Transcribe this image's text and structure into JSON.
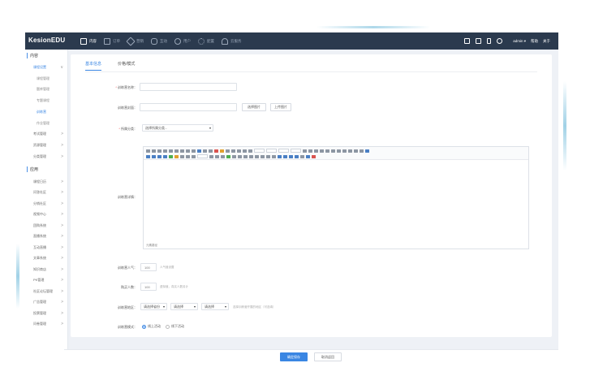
{
  "app": {
    "logo_main": "Kesion",
    "logo_sub": "EDU"
  },
  "topnav": [
    {
      "label": "内容",
      "icon": "document-icon",
      "active": true
    },
    {
      "label": "订单",
      "icon": "order-icon"
    },
    {
      "label": "营销",
      "icon": "tag-icon"
    },
    {
      "label": "互动",
      "icon": "chat-icon"
    },
    {
      "label": "用户",
      "icon": "user-icon"
    },
    {
      "label": "配置",
      "icon": "gear-icon"
    },
    {
      "label": "云服务",
      "icon": "cloud-icon"
    }
  ],
  "topright": {
    "user": "admin ▾",
    "help": "帮助",
    "about": "关于"
  },
  "sidebar": {
    "section_content": "内容",
    "items_content": [
      {
        "label": "课程设置",
        "arrow": "∨",
        "active": true
      },
      {
        "label": "课程管理",
        "sub": true
      },
      {
        "label": "题库管理",
        "sub": true
      },
      {
        "label": "专题课程",
        "sub": true
      },
      {
        "label": "训练营",
        "sub": true,
        "on": true
      },
      {
        "label": "作业管理",
        "sub": true
      },
      {
        "label": "考试管理",
        "arrow": ">"
      },
      {
        "label": "资源管理",
        "arrow": ">"
      },
      {
        "label": "分类管理",
        "arrow": ">"
      }
    ],
    "section_apps": "应用",
    "items_apps": [
      {
        "label": "课程日历",
        "arrow": ">"
      },
      {
        "label": "问答社区",
        "arrow": ">"
      },
      {
        "label": "分销社区",
        "arrow": ">"
      },
      {
        "label": "视频中心",
        "arrow": ">"
      },
      {
        "label": "团购系统",
        "arrow": ">"
      },
      {
        "label": "直播系统",
        "arrow": ">"
      },
      {
        "label": "互动直播",
        "arrow": ">"
      },
      {
        "label": "文章系统",
        "arrow": ">"
      },
      {
        "label": "知识商店",
        "arrow": ">"
      },
      {
        "label": "PK管理",
        "arrow": ">"
      },
      {
        "label": "社区论坛管理",
        "arrow": ">"
      },
      {
        "label": "广告管理",
        "arrow": ">"
      },
      {
        "label": "投票管理",
        "arrow": ">"
      },
      {
        "label": "问卷管理",
        "arrow": ">"
      }
    ]
  },
  "tabs": [
    "基本信息",
    "价格/模式"
  ],
  "form": {
    "name_label": "训练营名称：",
    "cover_label": "训练营封面：",
    "cover_select_btn": "选择图片",
    "cover_upload_btn": "上传图片",
    "category_label": "所属分类：",
    "category_value": "选择所属分类...",
    "intro_label": "训练营详情：",
    "editor_footer": "元素路径",
    "popularity_label": "训练营人气：",
    "popularity_value": "100",
    "popularity_hint": "人气值设置",
    "buyers_label": "购买人数：",
    "buyers_value": "100",
    "buyers_hint": "虚拟值，真实人数另计",
    "region_label": "训练营地区：",
    "region_province": "请选择省份",
    "region_city": "请选择",
    "region_district": "请选择",
    "region_hint": "选择训练营开展的地区（可选填）",
    "mode_label": "训练营模式：",
    "mode_online": "线上活动",
    "mode_offline": "线下活动"
  },
  "footer": {
    "save_label": "确定保存",
    "cancel_label": "取消返回"
  },
  "colors": {
    "accent": "#3a86e3",
    "topbar": "#2b3a4e",
    "bg": "#eef1f6"
  }
}
